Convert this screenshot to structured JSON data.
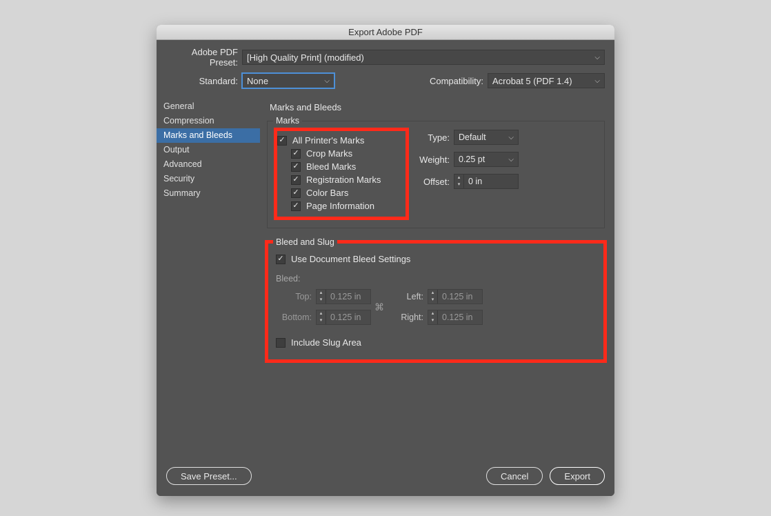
{
  "window": {
    "title": "Export Adobe PDF"
  },
  "header": {
    "preset_label": "Adobe PDF Preset:",
    "preset_value": "[High Quality Print] (modified)",
    "standard_label": "Standard:",
    "standard_value": "None",
    "compatibility_label": "Compatibility:",
    "compatibility_value": "Acrobat 5 (PDF 1.4)"
  },
  "sidebar": {
    "items": [
      {
        "label": "General"
      },
      {
        "label": "Compression"
      },
      {
        "label": "Marks and Bleeds"
      },
      {
        "label": "Output"
      },
      {
        "label": "Advanced"
      },
      {
        "label": "Security"
      },
      {
        "label": "Summary"
      }
    ],
    "selected_index": 2
  },
  "main": {
    "title": "Marks and Bleeds",
    "marks": {
      "legend": "Marks",
      "all_printers_marks": "All Printer's Marks",
      "crop_marks": "Crop Marks",
      "bleed_marks": "Bleed Marks",
      "registration_marks": "Registration Marks",
      "color_bars": "Color Bars",
      "page_information": "Page Information",
      "type_label": "Type:",
      "type_value": "Default",
      "weight_label": "Weight:",
      "weight_value": "0.25 pt",
      "offset_label": "Offset:",
      "offset_value": "0 in"
    },
    "bleed": {
      "legend": "Bleed and Slug",
      "use_document_bleed": "Use Document Bleed Settings",
      "bleed_label": "Bleed:",
      "top_label": "Top:",
      "top_value": "0.125 in",
      "bottom_label": "Bottom:",
      "bottom_value": "0.125 in",
      "left_label": "Left:",
      "left_value": "0.125 in",
      "right_label": "Right:",
      "right_value": "0.125 in",
      "include_slug": "Include Slug Area"
    }
  },
  "footer": {
    "save_preset": "Save Preset...",
    "cancel": "Cancel",
    "export": "Export"
  }
}
